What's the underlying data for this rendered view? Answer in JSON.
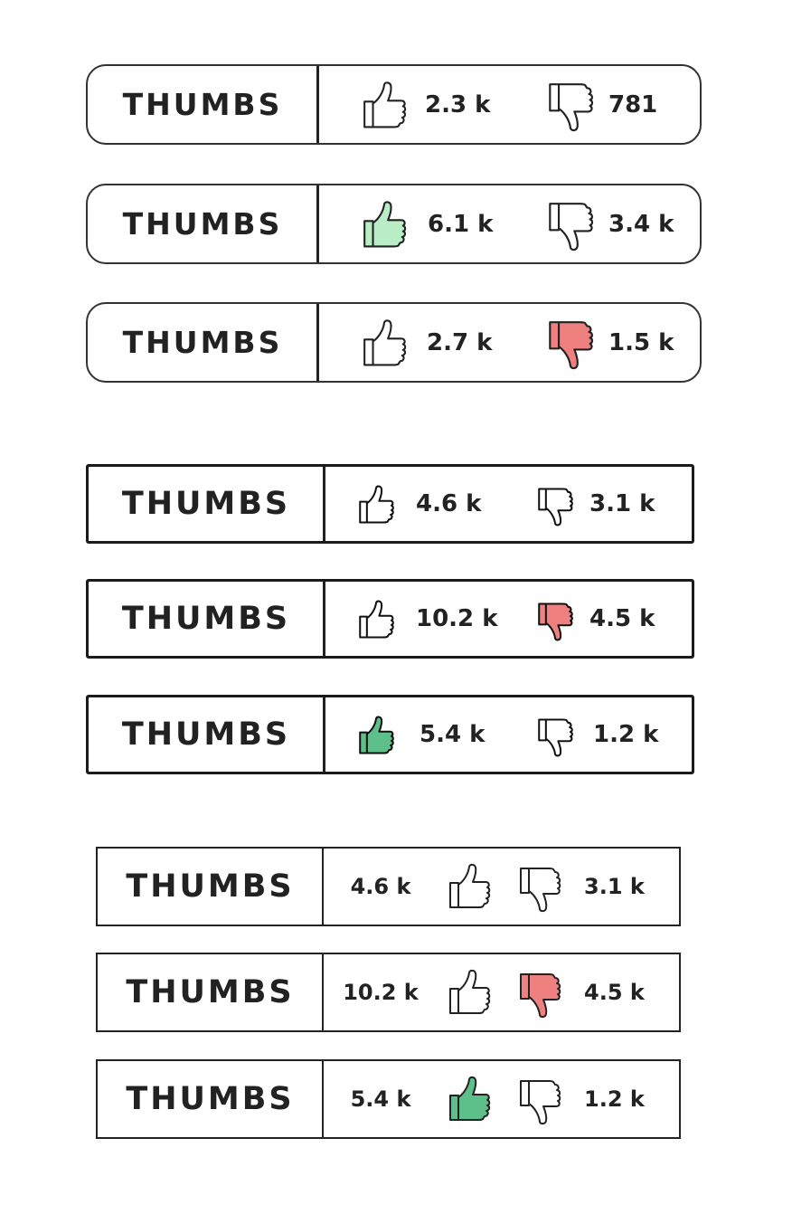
{
  "colors": {
    "outline": "#222222",
    "liked_light": "#b9edc5",
    "liked_dark": "#5dc08a",
    "disliked": "#ef8080"
  },
  "icons": {
    "up": "thumbs-up-icon",
    "down": "thumbs-down-icon"
  },
  "group_rounded": [
    {
      "label": "THUMBS",
      "up": "2.3 k",
      "down": "781",
      "state": "none"
    },
    {
      "label": "THUMBS",
      "up": "6.1 k",
      "down": "3.4 k",
      "state": "up"
    },
    {
      "label": "THUMBS",
      "up": "2.7 k",
      "down": "1.5 k",
      "state": "down"
    }
  ],
  "group_square": [
    {
      "label": "THUMBS",
      "up": "4.6 k",
      "down": "3.1 k",
      "state": "none"
    },
    {
      "label": "THUMBS",
      "up": "10.2 k",
      "down": "4.5 k",
      "state": "down"
    },
    {
      "label": "THUMBS",
      "up": "5.4 k",
      "down": "1.2 k",
      "state": "up"
    }
  ],
  "group_compact": [
    {
      "label": "THUMBS",
      "up": "4.6 k",
      "down": "3.1 k",
      "state": "none"
    },
    {
      "label": "THUMBS",
      "up": "10.2 k",
      "down": "4.5 k",
      "state": "down"
    },
    {
      "label": "THUMBS",
      "up": "5.4 k",
      "down": "1.2 k",
      "state": "up"
    }
  ]
}
